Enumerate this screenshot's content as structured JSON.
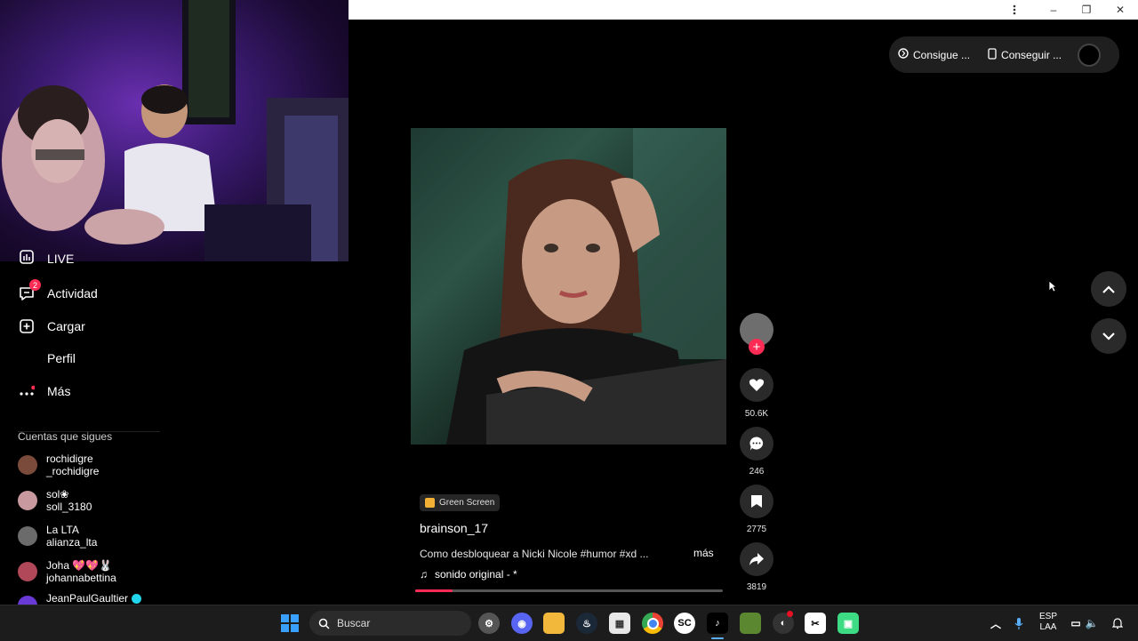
{
  "window": {
    "menu_icon": "kebab-icon",
    "minimize": "–",
    "restore": "❐",
    "close": "✕"
  },
  "topbar": {
    "coins_label": "Consigue ...",
    "app_label": "Conseguir ..."
  },
  "sidebar": {
    "items": [
      {
        "label": "LIVE",
        "icon": "live-icon"
      },
      {
        "label": "Actividad",
        "icon": "inbox-icon",
        "badge": "2"
      },
      {
        "label": "Cargar",
        "icon": "upload-icon"
      },
      {
        "label": "Perfil",
        "icon": "profile-icon"
      },
      {
        "label": "Más",
        "icon": "more-icon"
      }
    ],
    "following_title": "Cuentas que sigues",
    "following": [
      {
        "name": "rochidigre",
        "handle": "_rochidigre",
        "color": "#7a4b3a"
      },
      {
        "name": "sol❀",
        "handle": "soll_3180",
        "color": "#c89aa0"
      },
      {
        "name": "La LTA",
        "handle": "alianza_lta",
        "color": "#6b6b6b"
      },
      {
        "name": "Joha 💖💖🐰",
        "handle": "johannabettina",
        "color": "#b0485a"
      },
      {
        "name": "JeanPaulGaultier",
        "handle": "",
        "color": "#6a3ad6"
      }
    ]
  },
  "video": {
    "effect_tag": "Green Screen",
    "author": "brainson_17",
    "caption": "Como desbloquear a Nicki Nicole #humor #xd ...",
    "more": "más",
    "sound": "sonido original - *",
    "progress": 0.12
  },
  "actions": {
    "likes": "50.6K",
    "comments": "246",
    "saves": "2775",
    "shares": "3819"
  },
  "taskbar": {
    "search_placeholder": "Buscar",
    "lang_top": "ESP",
    "lang_bottom": "LAA",
    "apps": [
      "settings",
      "discord",
      "file-explorer",
      "steam",
      "store",
      "chrome",
      "soundcloud",
      "tiktok",
      "minecraft",
      "obs",
      "capcut",
      "android"
    ]
  }
}
